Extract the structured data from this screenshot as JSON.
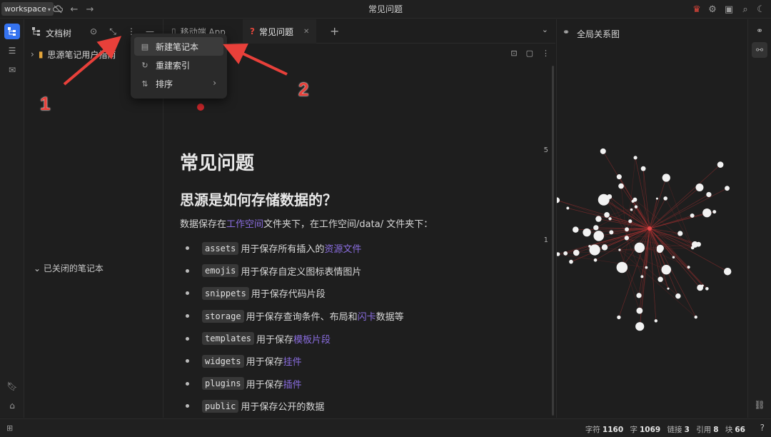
{
  "window": {
    "title": "常见问题",
    "workspace": "workspace"
  },
  "left_dock": {
    "items": [
      "file-tree-icon",
      "outline-icon",
      "inbox-icon",
      "bookmark-icon",
      "tag-icon"
    ]
  },
  "file_tree": {
    "title": "文档树",
    "notebook": "思源笔记用户指南",
    "closed_section": "已关闭的笔记本"
  },
  "menu": {
    "items": [
      {
        "label": "新建笔记本",
        "icon": "notebook-icon"
      },
      {
        "label": "重建索引",
        "icon": "refresh-icon"
      },
      {
        "label": "排序",
        "icon": "sort-icon"
      }
    ]
  },
  "tabs": [
    {
      "label": "移动端 App",
      "active": false
    },
    {
      "label": "常见问题",
      "active": true
    }
  ],
  "doc": {
    "title": "常见问题",
    "h2": "思源是如何存储数据的？",
    "p_pre": "数据保存在",
    "p_link": "工作空间",
    "p_post": "文件夹下，在工作空间/data/ 文件夹下：",
    "bullets": [
      {
        "code": "assets",
        "text": "用于保存所有插入的",
        "link": "资源文件",
        "after": ""
      },
      {
        "code": "emojis",
        "text": "用于保存自定义图标表情图片",
        "link": "",
        "after": ""
      },
      {
        "code": "snippets",
        "text": "用于保存代码片段",
        "link": "",
        "after": ""
      },
      {
        "code": "storage",
        "text": "用于保存查询条件、布局和",
        "link": "闪卡",
        "after": "数据等"
      },
      {
        "code": "templates",
        "text": "用于保存",
        "link": "模板片段",
        "after": ""
      },
      {
        "code": "widgets",
        "text": "用于保存",
        "link": "挂件",
        "after": ""
      },
      {
        "code": "plugins",
        "text": "用于保存",
        "link": "插件",
        "after": ""
      },
      {
        "code": "public",
        "text": "用于保存公开的数据",
        "link": "",
        "after": ""
      }
    ],
    "gutter_numbers": [
      "5",
      "1"
    ]
  },
  "graph": {
    "title": "全局关系图"
  },
  "status": {
    "chars_label": "字符",
    "chars": "1160",
    "words_label": "字",
    "words": "1069",
    "links_label": "链接",
    "links": "3",
    "refs_label": "引用",
    "refs": "8",
    "blocks_label": "块",
    "blocks": "66"
  },
  "annotations": {
    "one": "1",
    "two": "2"
  },
  "colors": {
    "accent": "#3573f0",
    "link": "#8a6de0",
    "annotation": "#e8403a"
  }
}
